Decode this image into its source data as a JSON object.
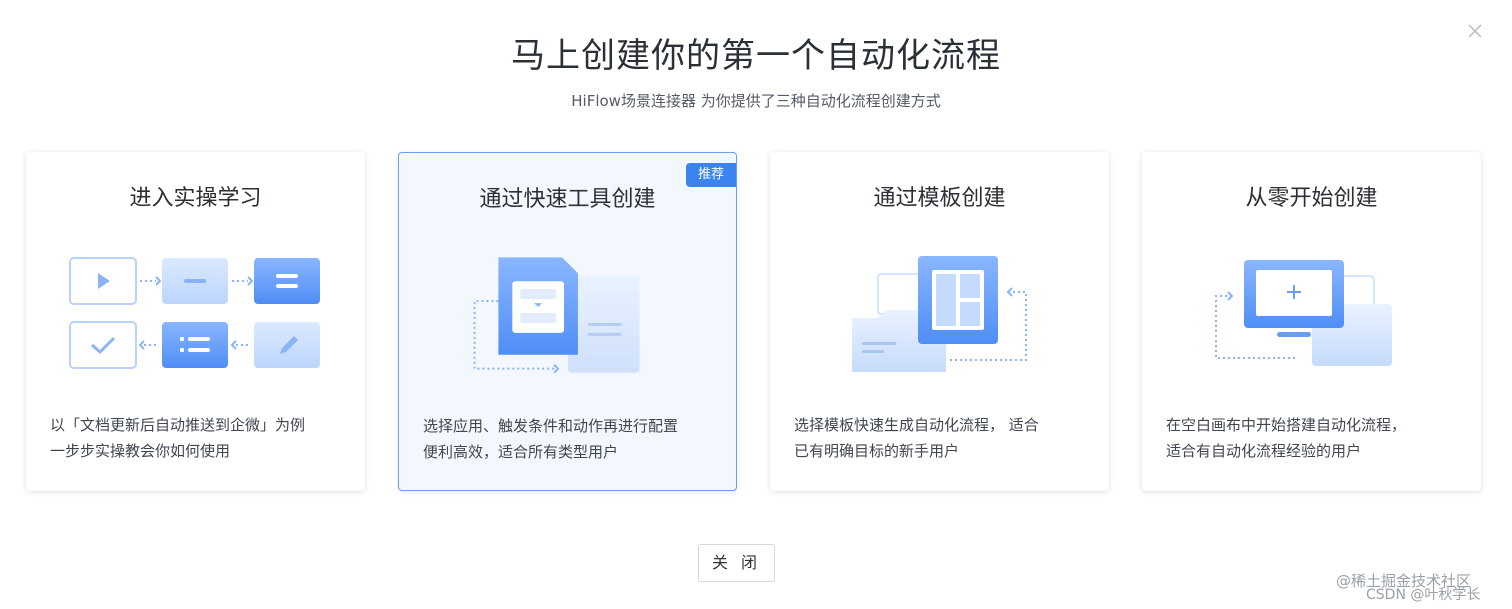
{
  "dialog": {
    "title": "马上创建你的第一个自动化流程",
    "subtitle": "HiFlow场景连接器 为你提供了三种自动化流程创建方式",
    "close_button": "关 闭"
  },
  "cards": [
    {
      "title": "进入实操学习",
      "desc_line1": "以「文档更新后自动推送到企微」为例",
      "desc_line2": "一步步实操教会你如何使用"
    },
    {
      "title": "通过快速工具创建",
      "badge": "推荐",
      "desc_line1": "选择应用、触发条件和动作再进行配置",
      "desc_line2": "便利高效，适合所有类型用户"
    },
    {
      "title": "通过模板创建",
      "desc_line1": "选择模板快速生成自动化流程， 适合",
      "desc_line2": "已有明确目标的新手用户"
    },
    {
      "title": "从零开始创建",
      "desc_line1": "在空白画布中开始搭建自动化流程，",
      "desc_line2": "适合有自动化流程经验的用户"
    }
  ],
  "watermarks": {
    "juejin": "@稀土掘金技术社区",
    "csdn": "CSDN @叶秋学长"
  },
  "colors": {
    "accent": "#3a84f0",
    "active_card_bg": "#f3f8ff",
    "active_card_border": "#6a9ff0"
  }
}
